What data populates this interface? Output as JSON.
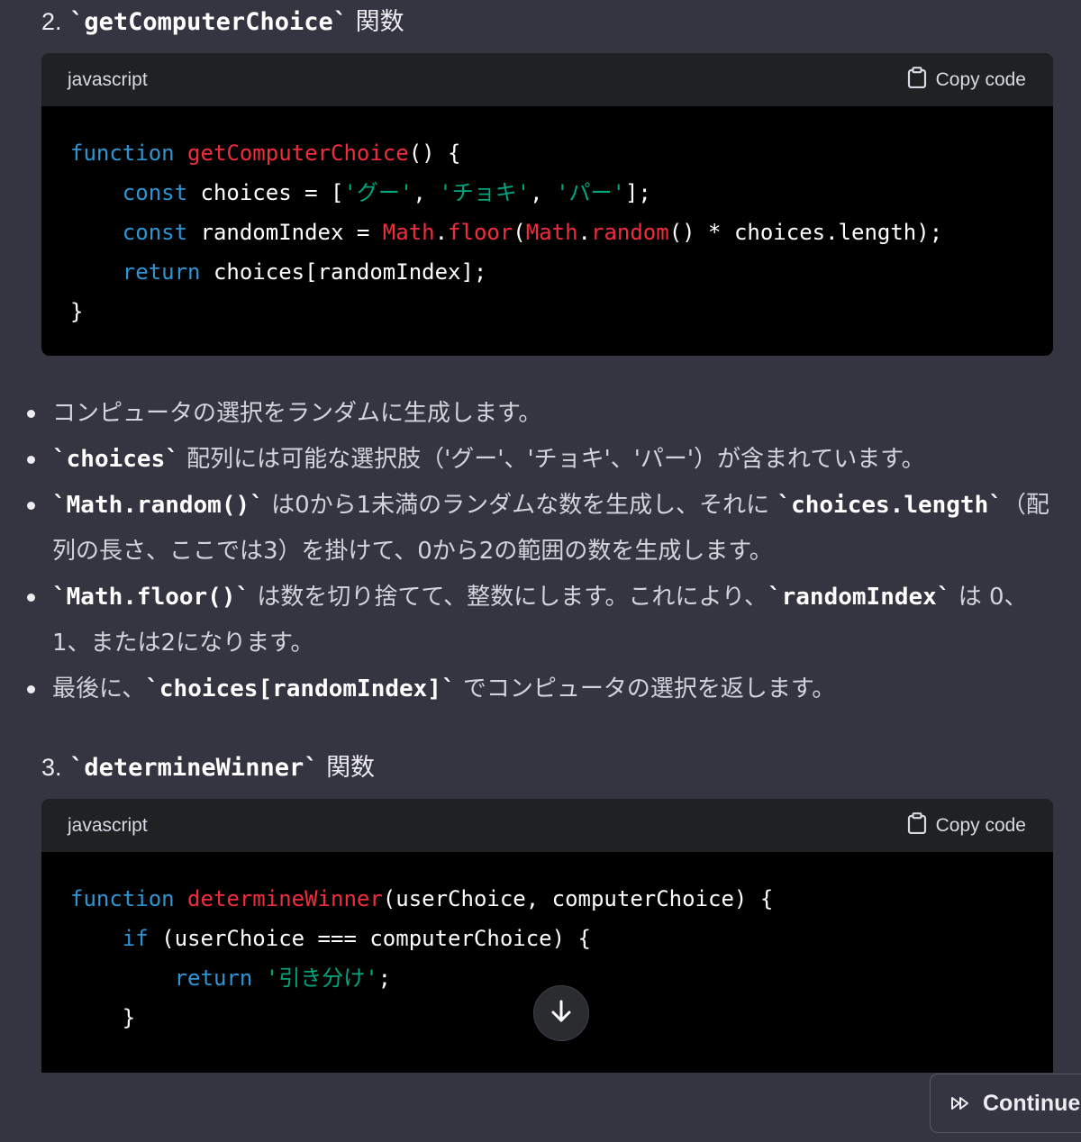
{
  "section2": {
    "heading_number": "2.",
    "heading_code": "`getComputerChoice`",
    "heading_suffix": "関数",
    "code_lang": "javascript",
    "copy_label": "Copy code",
    "code_lines": [
      [
        {
          "t": "function",
          "c": "kw"
        },
        {
          "t": " "
        },
        {
          "t": "getComputerChoice",
          "c": "fn"
        },
        {
          "t": "() {"
        }
      ],
      [
        {
          "t": "    "
        },
        {
          "t": "const",
          "c": "kw"
        },
        {
          "t": " choices = ["
        },
        {
          "t": "'グー'",
          "c": "str"
        },
        {
          "t": ", "
        },
        {
          "t": "'チョキ'",
          "c": "str"
        },
        {
          "t": ", "
        },
        {
          "t": "'パー'",
          "c": "str"
        },
        {
          "t": "];"
        }
      ],
      [
        {
          "t": "    "
        },
        {
          "t": "const",
          "c": "kw"
        },
        {
          "t": " randomIndex = "
        },
        {
          "t": "Math",
          "c": "fn"
        },
        {
          "t": "."
        },
        {
          "t": "floor",
          "c": "fn"
        },
        {
          "t": "("
        },
        {
          "t": "Math",
          "c": "fn"
        },
        {
          "t": "."
        },
        {
          "t": "random",
          "c": "fn"
        },
        {
          "t": "() * choices.length);"
        }
      ],
      [
        {
          "t": "    "
        },
        {
          "t": "return",
          "c": "kw"
        },
        {
          "t": " choices[randomIndex];"
        }
      ],
      [
        {
          "t": "}"
        }
      ]
    ]
  },
  "bullets": [
    [
      {
        "t": "コンピュータの選択をランダムに生成します。"
      }
    ],
    [
      {
        "t": "`choices`",
        "code": true
      },
      {
        "t": " 配列には可能な選択肢（'グー'、'チョキ'、'パー'）が含まれています。"
      }
    ],
    [
      {
        "t": "`Math.random()`",
        "code": true
      },
      {
        "t": " は0から1未満のランダムな数を生成し、それに "
      },
      {
        "t": "`choices.length`",
        "code": true
      },
      {
        "t": "（配列の長さ、ここでは3）を掛けて、0から2の範囲の数を生成します。"
      }
    ],
    [
      {
        "t": "`Math.floor()`",
        "code": true
      },
      {
        "t": " は数を切り捨てて、整数にします。これにより、"
      },
      {
        "t": "`randomIndex`",
        "code": true
      },
      {
        "t": " は 0、1、または2になります。"
      }
    ],
    [
      {
        "t": "最後に、"
      },
      {
        "t": "`choices[randomIndex]`",
        "code": true
      },
      {
        "t": " でコンピュータの選択を返します。"
      }
    ]
  ],
  "section3": {
    "heading_number": "3.",
    "heading_code": "`determineWinner`",
    "heading_suffix": "関数",
    "code_lang": "javascript",
    "copy_label": "Copy code",
    "code_lines": [
      [
        {
          "t": "function",
          "c": "kw"
        },
        {
          "t": " "
        },
        {
          "t": "determineWinner",
          "c": "fn"
        },
        {
          "t": "(userChoice, computerChoice) {"
        }
      ],
      [
        {
          "t": "    "
        },
        {
          "t": "if",
          "c": "kw"
        },
        {
          "t": " (userChoice === computerChoice) {"
        }
      ],
      [
        {
          "t": "        "
        },
        {
          "t": "return",
          "c": "kw"
        },
        {
          "t": " "
        },
        {
          "t": "'引き分け'",
          "c": "str"
        },
        {
          "t": ";"
        }
      ],
      [
        {
          "t": "    }"
        }
      ]
    ]
  },
  "continue_label": "Continue",
  "icons": {
    "clipboard": "clipboard-icon",
    "arrow_down": "arrow-down-icon",
    "fast_forward": "fast-forward-icon"
  },
  "colors": {
    "background": "#343541",
    "code_bg": "#000000",
    "code_header": "#202123",
    "keyword": "#2e95d3",
    "function": "#f22c3d",
    "string": "#00a67d"
  }
}
